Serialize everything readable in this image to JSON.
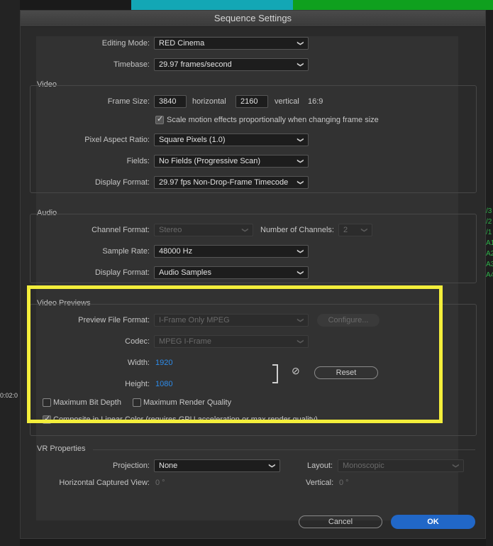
{
  "dialog": {
    "title": "Sequence Settings"
  },
  "editing_mode": {
    "label": "Editing Mode:",
    "value": "RED Cinema"
  },
  "timebase": {
    "label": "Timebase:",
    "value": "29.97  frames/second"
  },
  "video": {
    "section": "Video",
    "frame_size_label": "Frame Size:",
    "width": "3840",
    "horizontal_label": "horizontal",
    "height": "2160",
    "vertical_label": "vertical",
    "aspect": "16:9",
    "scale_label": "Scale motion effects proportionally when changing frame size",
    "scale_checked": true,
    "par_label": "Pixel Aspect Ratio:",
    "par_value": "Square Pixels (1.0)",
    "fields_label": "Fields:",
    "fields_value": "No Fields (Progressive Scan)",
    "display_format_label": "Display Format:",
    "display_format_value": "29.97 fps Non-Drop-Frame Timecode"
  },
  "audio": {
    "section": "Audio",
    "channel_format_label": "Channel Format:",
    "channel_format_value": "Stereo",
    "num_channels_label": "Number of Channels:",
    "num_channels_value": "2",
    "sample_rate_label": "Sample Rate:",
    "sample_rate_value": "48000 Hz",
    "display_format_label": "Display Format:",
    "display_format_value": "Audio Samples"
  },
  "previews": {
    "section": "Video Previews",
    "file_format_label": "Preview File Format:",
    "file_format_value": "I-Frame Only MPEG",
    "configure_label": "Configure...",
    "codec_label": "Codec:",
    "codec_value": "MPEG I-Frame",
    "width_label": "Width:",
    "width_value": "1920",
    "height_label": "Height:",
    "height_value": "1080",
    "reset_label": "Reset",
    "max_bit_depth_label": "Maximum Bit Depth",
    "max_render_quality_label": "Maximum Render Quality",
    "composite_label": "Composite in Linear Color (requires GPU acceleration or max render quality)"
  },
  "vr": {
    "section": "VR Properties",
    "projection_label": "Projection:",
    "projection_value": "None",
    "layout_label": "Layout:",
    "layout_value": "Monoscopic",
    "hcv_label": "Horizontal Captured View:",
    "hcv_value": "0 °",
    "vertical_label": "Vertical:",
    "vertical_value": "0 °"
  },
  "buttons": {
    "cancel": "Cancel",
    "ok": "OK"
  },
  "background": {
    "timecode": "0:02:0",
    "right_glyphs": "/3\n/2\n/1\nA1\nA2\nA3\nA4"
  },
  "colors": {
    "highlight": "#f3ee3b",
    "ok_button": "#2167c7",
    "link_value": "#2d8ceb"
  }
}
